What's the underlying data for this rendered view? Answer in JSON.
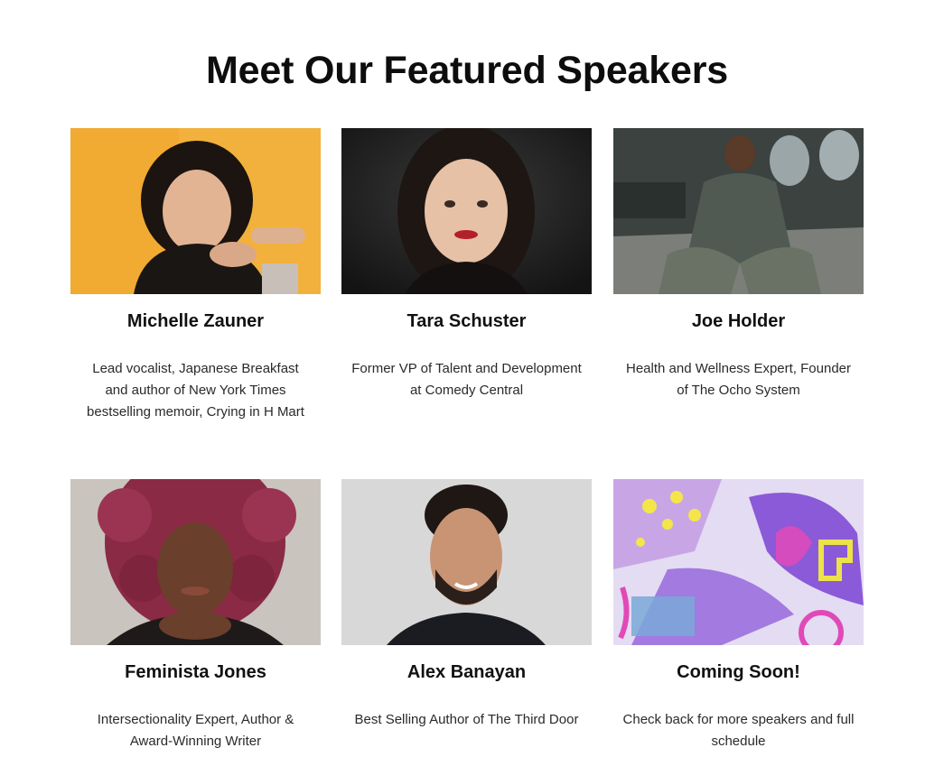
{
  "page": {
    "title": "Meet Our Featured Speakers"
  },
  "speakers": [
    {
      "name": "Michelle Zauner",
      "description": "Lead vocalist, Japanese Breakfast and author of New York Times bestselling memoir, Crying in H Mart"
    },
    {
      "name": "Tara Schuster",
      "description": "Former VP of Talent and Development at Comedy Central"
    },
    {
      "name": "Joe Holder",
      "description": "Health and Wellness Expert, Founder of The Ocho System"
    },
    {
      "name": "Feminista Jones",
      "description": "Intersectionality Expert, Author & Award-Winning Writer"
    },
    {
      "name": "Alex Banayan",
      "description": "Best Selling Author of The Third Door"
    },
    {
      "name": "Coming Soon!",
      "description": "Check back for more speakers and full schedule"
    }
  ]
}
